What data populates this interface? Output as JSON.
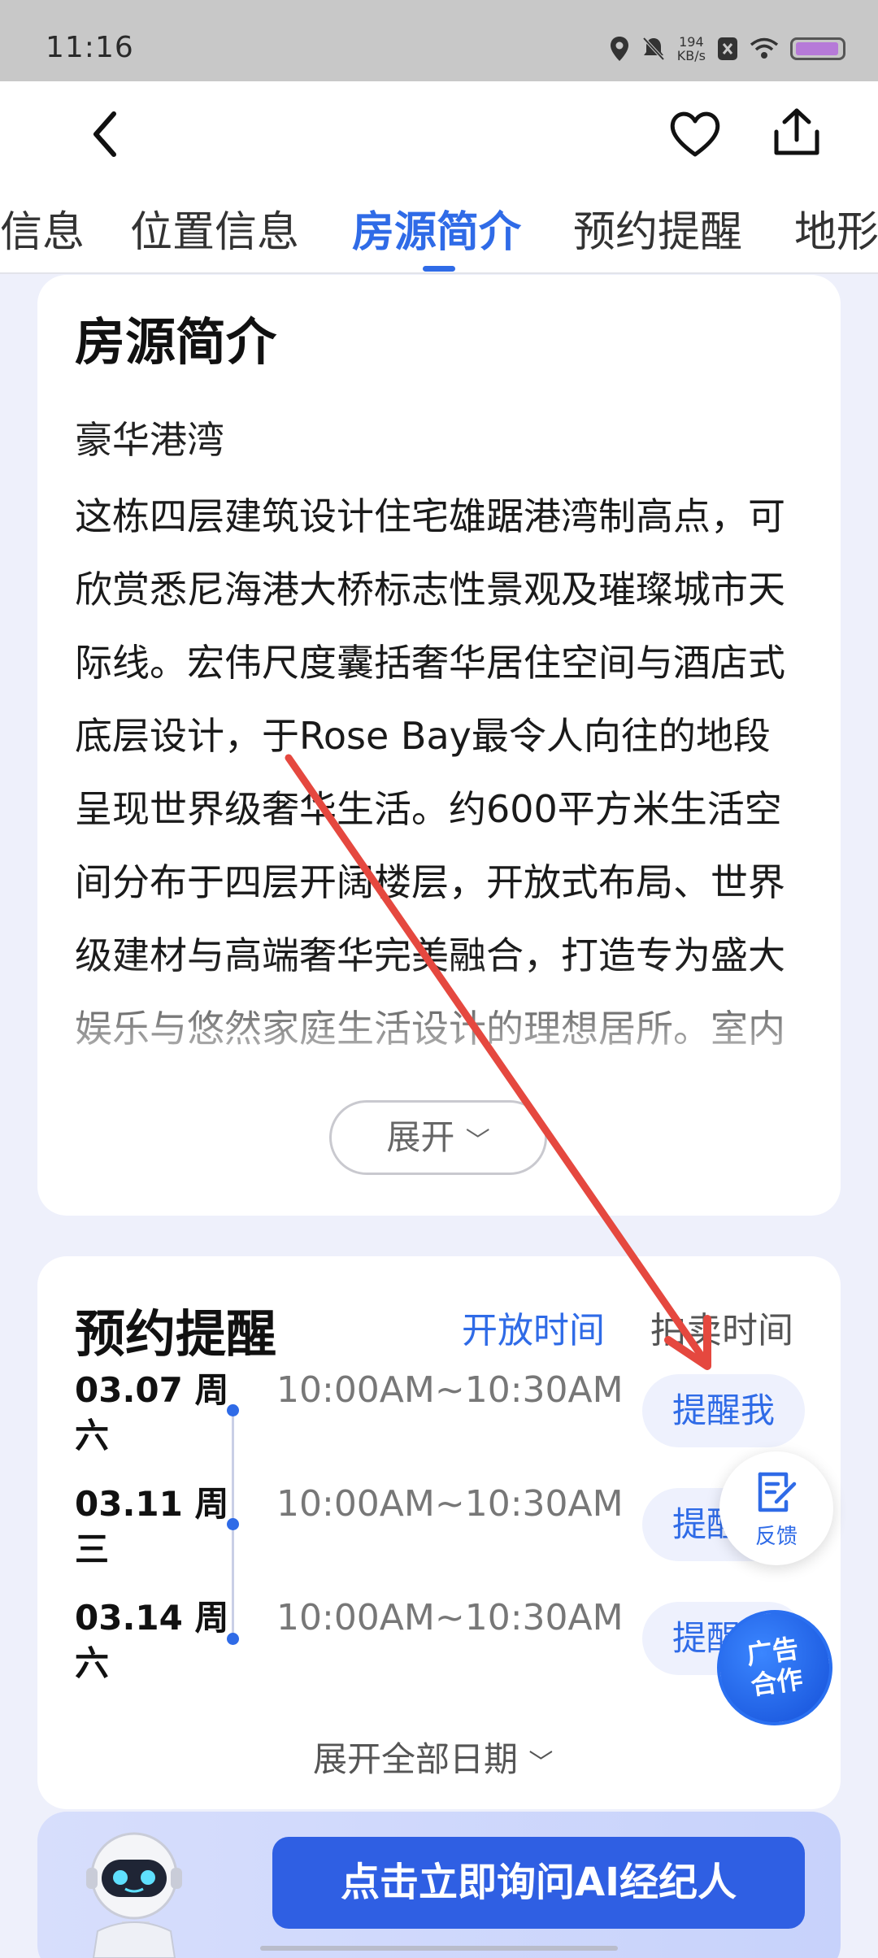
{
  "status_bar": {
    "time": "11:16",
    "net_speed_value": "194",
    "net_speed_unit": "KB/s"
  },
  "header": {
    "back_icon": "chevron-left-icon",
    "favorite_icon": "heart-icon",
    "share_icon": "share-icon",
    "tabs": [
      {
        "label": "信息"
      },
      {
        "label": "位置信息"
      },
      {
        "label": "房源简介",
        "active": true
      },
      {
        "label": "预约提醒"
      },
      {
        "label": "地形"
      }
    ],
    "accent_color": "#2f6be7"
  },
  "intro": {
    "title": "房源简介",
    "subtitle": "豪华港湾",
    "body": "这栋四层建筑设计住宅雄踞港湾制高点，可欣赏悉尼海港大桥标志性景观及璀璨城市天际线。宏伟尺度囊括奢华居住空间与酒店式底层设计，于Rose Bay最令人向往的地段呈现世界级奢华生活。约600平方米生活空间分布于四层开阔楼层，开放式布局、世界级建材与高端奢华完美融合，打造专为盛大娱乐与悠然家庭生活设计的理想居所。室内空",
    "expand_label": "展开"
  },
  "booking": {
    "title": "预约提醒",
    "tab_open": "开放时间",
    "tab_auction": "拍卖时间",
    "entries": [
      {
        "date": "03.07 周六",
        "time": "10:00AM~10:30AM",
        "button": "提醒我"
      },
      {
        "date": "03.11 周三",
        "time": "10:00AM~10:30AM",
        "button": "提醒我"
      },
      {
        "date": "03.14 周六",
        "time": "10:00AM~10:30AM",
        "button": "提醒我"
      }
    ],
    "expand_dates": "展开全部日期"
  },
  "floating": {
    "feedback_label": "反馈",
    "ad_label_line1": "广告",
    "ad_label_line2": "合作"
  },
  "ai_bar": {
    "button_label": "点击立即询问AI经纪人"
  }
}
